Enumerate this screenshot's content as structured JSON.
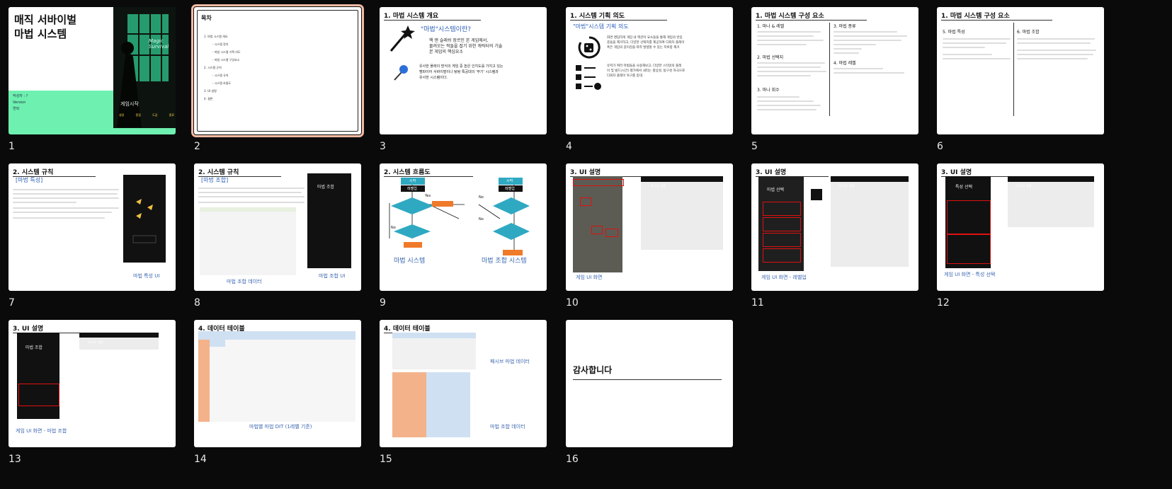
{
  "slides": [
    {
      "num": "1",
      "title": "매직 서바이벌\n마법 시스템",
      "meta1": "작성자 : ?",
      "meta2": "Version",
      "meta3": "연락",
      "game_title": "게임시작",
      "game_menu": [
        "설정",
        "종합",
        "도감",
        "종료"
      ],
      "logo": "Magic\nSurvival"
    },
    {
      "num": "2",
      "heading": "목차",
      "items": [
        "1. 마법 시스템 개요",
        "- 시스템 정의",
        "- 마법 시스템 기획 의도",
        "- 마법 시스템 구성요소",
        "2. 시스템 규칙",
        "- 시스템 규칙",
        "- 시스템 흐름도",
        "3. UI 설명",
        "4. 결론"
      ]
    },
    {
      "num": "3",
      "title": "1. 마법 시스템 개요",
      "heading": "\"마법\"시스템이란?",
      "p1": "핵 앤 슬래쉬 장르인 본 게임에서,\n몰려오는 적들을 잡기 위한 캐릭터의 기술\n본 게임의 핵심요소",
      "p2": "유사한 플레이 방식의 게임 중 높은 인지도를 가지고 있는\n뱀파이어 서바이벌이나 탕탕 특공대의 '무기' 시스템과\n유사한 시스템이다."
    },
    {
      "num": "4",
      "title": "1. 시스템 기획 의도",
      "heading": "\"마법\"시스템 기획 의도",
      "p1": "화면 랜덤하게 게임 내 액션이 요소들을 통해 게임의 반응\n종들을 제거하고, 다양한 선택지를 제공하여 다회차 플레이\n혹은 게임의 길이감을 따라 발생할 수 있는 지루함 제거",
      "p2": "유저가 여러 마법들을 사용해보고, 다양한 스타일의 플레\n이 및 빌드(시간) 평가에서 내리는 향상성, 탐구성 자극으로\n다회차 플레이 욕구를 증대."
    },
    {
      "num": "5",
      "title": "1. 마법 시스템 구성 요소",
      "left": [
        "1. 마나 & 레벨",
        "2. 마법 선택지",
        "3. 마나 회수"
      ],
      "right": [
        "3. 마법 종류",
        "4. 마법 레벨"
      ]
    },
    {
      "num": "6",
      "title": "1. 마법 시스템 구성 요소",
      "left": [
        "5. 마법 특성"
      ],
      "right": [
        "6. 마법 조합"
      ]
    },
    {
      "num": "7",
      "title": "2. 시스템 규칙",
      "heading": "[마법 특성]",
      "caption": "마법 특성 UI"
    },
    {
      "num": "8",
      "title": "2. 시스템 규칙",
      "heading": "[마법 조합]",
      "caption1": "마법 조합 데이터",
      "caption2": "마법 조합 UI",
      "phone_title": "마법 조합"
    },
    {
      "num": "9",
      "title": "2. 시스템 흐름도",
      "start": "시작",
      "box1": "레벨업",
      "box2": "레벨업",
      "no": "No",
      "yes": "Yes",
      "caption1": "마법 시스템",
      "caption2": "마법 조합 시스템"
    },
    {
      "num": "10",
      "title": "3. UI 설명",
      "caption": "게임 UI 화면",
      "table_head": "UI 요소 설명"
    },
    {
      "num": "11",
      "title": "3. UI 설명",
      "caption": "게임 UI 화면 - 레벨업",
      "table_head": "UI 요소 설명",
      "phone_title": "마법 선택"
    },
    {
      "num": "12",
      "title": "3. UI 설명",
      "caption": "게임 UI 화면 - 특성 선택",
      "table_head": "UI 요소 설명",
      "phone_title": "특성 선택"
    },
    {
      "num": "13",
      "title": "3. UI 설명",
      "caption": "게임 UI 화면 - 마법 조합",
      "table_head": "UI 요소 설명",
      "phone_title": "마법 조합"
    },
    {
      "num": "14",
      "title": "4. 데이터 테이블",
      "caption": "마법별 마법 DIT (1레벨 기준)"
    },
    {
      "num": "15",
      "title": "4. 데이터 테이블",
      "caption1": "패시브 마법 데이터",
      "caption2": "마법 조합 데이터"
    },
    {
      "num": "16",
      "heading": "감사합니다"
    }
  ],
  "colors": {
    "background": "#0a0a0a",
    "selected": "#f2b9a3",
    "accent": "#3a66b0",
    "teal": "#2fa9c2",
    "mint": "#6ef0b0"
  }
}
